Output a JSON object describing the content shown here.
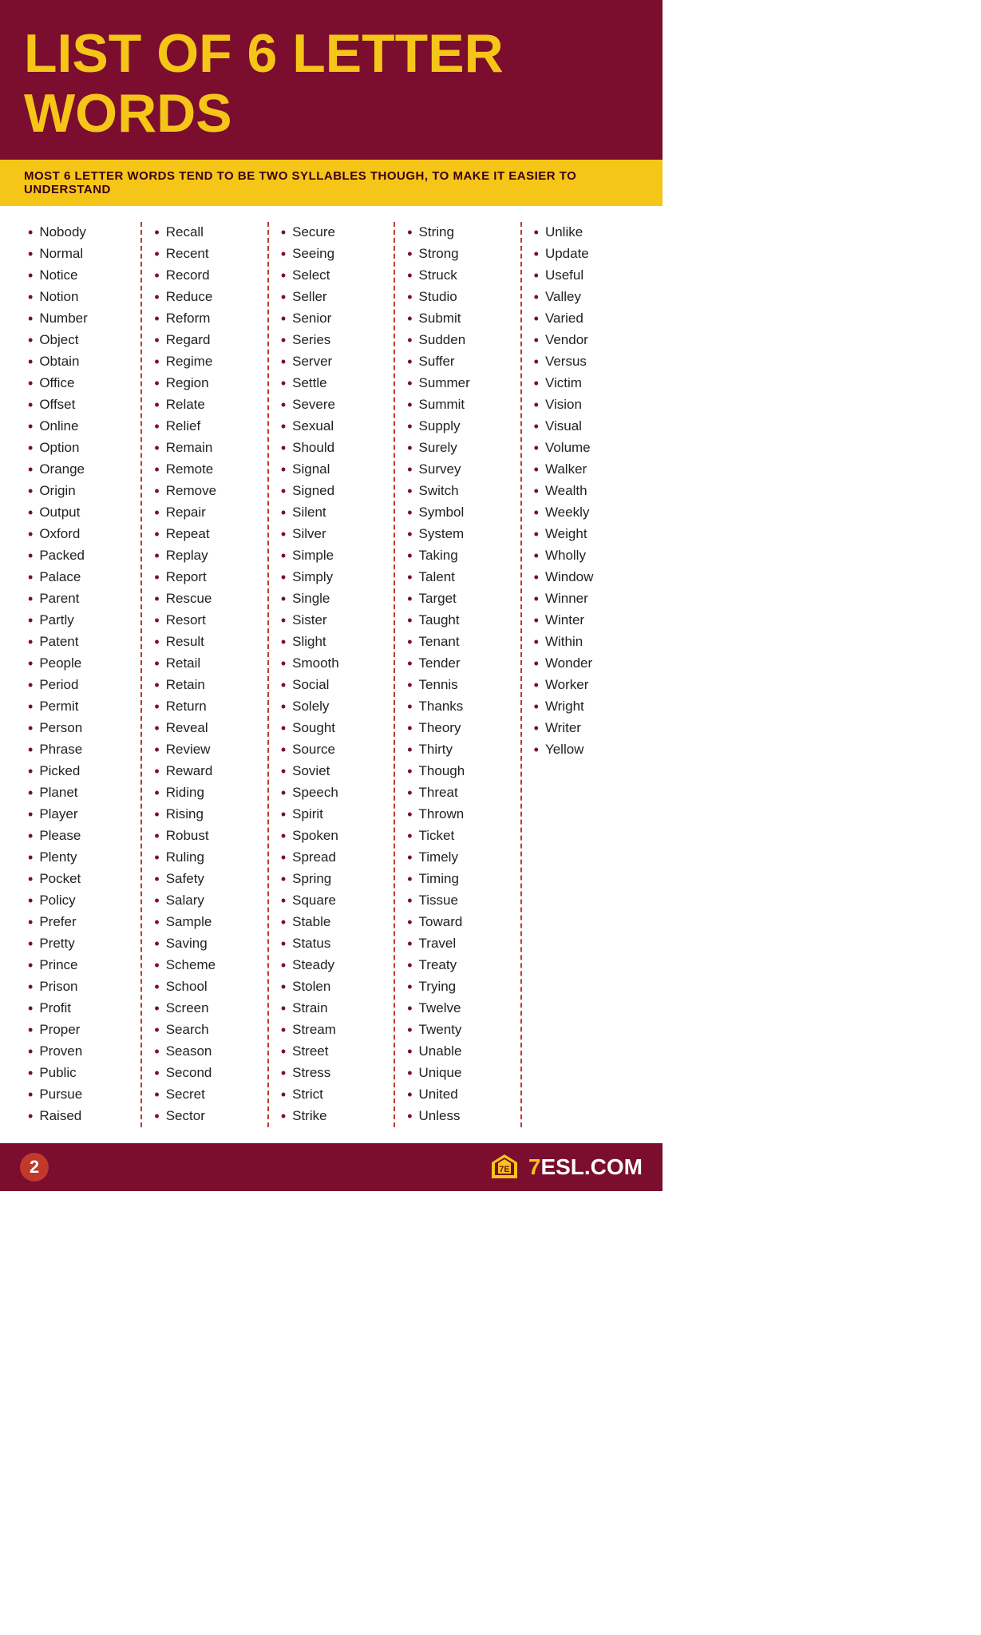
{
  "header": {
    "title": "LIST OF 6 LETTER WORDS",
    "subtitle": "MOST 6 LETTER WORDS TEND TO BE TWO SYLLABLES THOUGH, TO MAKE IT EASIER TO UNDERSTAND"
  },
  "columns": [
    {
      "words": [
        "Nobody",
        "Normal",
        "Notice",
        "Notion",
        "Number",
        "Object",
        "Obtain",
        "Office",
        "Offset",
        "Online",
        "Option",
        "Orange",
        "Origin",
        "Output",
        "Oxford",
        "Packed",
        "Palace",
        "Parent",
        "Partly",
        "Patent",
        "People",
        "Period",
        "Permit",
        "Person",
        "Phrase",
        "Picked",
        "Planet",
        "Player",
        "Please",
        "Plenty",
        "Pocket",
        "Policy",
        "Prefer",
        "Pretty",
        "Prince",
        "Prison",
        "Profit",
        "Proper",
        "Proven",
        "Public",
        "Pursue",
        "Raised"
      ]
    },
    {
      "words": [
        "Recall",
        "Recent",
        "Record",
        "Reduce",
        "Reform",
        "Regard",
        "Regime",
        "Region",
        "Relate",
        "Relief",
        "Remain",
        "Remote",
        "Remove",
        "Repair",
        "Repeat",
        "Replay",
        "Report",
        "Rescue",
        "Resort",
        "Result",
        "Retail",
        "Retain",
        "Return",
        "Reveal",
        "Review",
        "Reward",
        "Riding",
        "Rising",
        "Robust",
        "Ruling",
        "Safety",
        "Salary",
        "Sample",
        "Saving",
        "Scheme",
        "School",
        "Screen",
        "Search",
        "Season",
        "Second",
        "Secret",
        "Sector"
      ]
    },
    {
      "words": [
        "Secure",
        "Seeing",
        "Select",
        "Seller",
        "Senior",
        "Series",
        "Server",
        "Settle",
        "Severe",
        "Sexual",
        "Should",
        "Signal",
        "Signed",
        "Silent",
        "Silver",
        "Simple",
        "Simply",
        "Single",
        "Sister",
        "Slight",
        "Smooth",
        "Social",
        "Solely",
        "Sought",
        "Source",
        "Soviet",
        "Speech",
        "Spirit",
        "Spoken",
        "Spread",
        "Spring",
        "Square",
        "Stable",
        "Status",
        "Steady",
        "Stolen",
        "Strain",
        "Stream",
        "Street",
        "Stress",
        "Strict",
        "Strike"
      ]
    },
    {
      "words": [
        "String",
        "Strong",
        "Struck",
        "Studio",
        "Submit",
        "Sudden",
        "Suffer",
        "Summer",
        "Summit",
        "Supply",
        "Surely",
        "Survey",
        "Switch",
        "Symbol",
        "System",
        "Taking",
        "Talent",
        "Target",
        "Taught",
        "Tenant",
        "Tender",
        "Tennis",
        "Thanks",
        "Theory",
        "Thirty",
        "Though",
        "Threat",
        "Thrown",
        "Ticket",
        "Timely",
        "Timing",
        "Tissue",
        "Toward",
        "Travel",
        "Treaty",
        "Trying",
        "Twelve",
        "Twenty",
        "Unable",
        "Unique",
        "United",
        "Unless"
      ]
    },
    {
      "words": [
        "Unlike",
        "Update",
        "Useful",
        "Valley",
        "Varied",
        "Vendor",
        "Versus",
        "Victim",
        "Vision",
        "Visual",
        "Volume",
        "Walker",
        "Wealth",
        "Weekly",
        "Weight",
        "Wholly",
        "Window",
        "Winner",
        "Winter",
        "Within",
        "Wonder",
        "Worker",
        "Wright",
        "Writer",
        "Yellow"
      ]
    }
  ],
  "footer": {
    "page": "2",
    "logo_text": "7ESL.COM"
  }
}
